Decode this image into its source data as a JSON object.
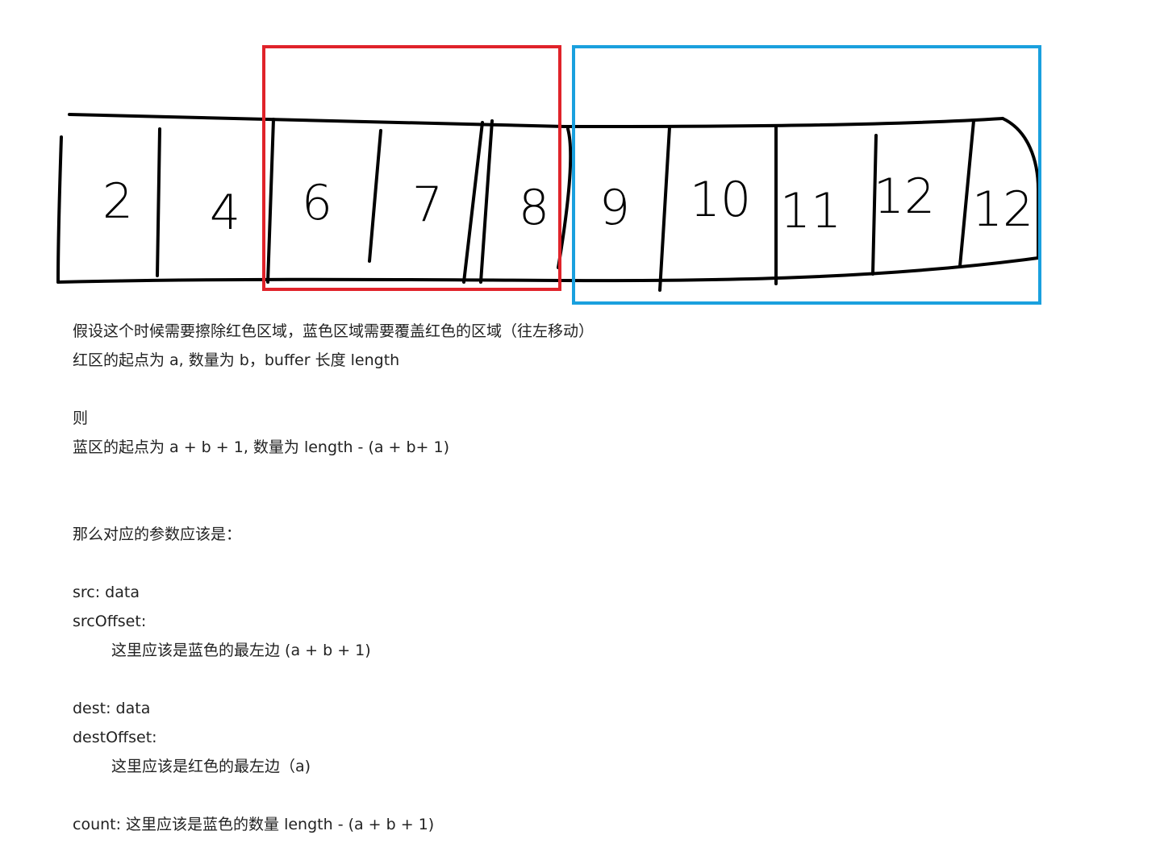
{
  "diagram": {
    "cells": [
      "2",
      "4",
      "6",
      "7",
      "8",
      "9",
      "10",
      "11",
      "12",
      "12"
    ],
    "highlight_colors": {
      "red_region": "#e0232a",
      "blue_region": "#1aa0de"
    }
  },
  "notes": {
    "line1": "假设这个时候需要擦除红色区域，蓝色区域需要覆盖红色的区域（往左移动）",
    "line2": "红区的起点为 a, 数量为 b，buffer 长度 length",
    "line3": "则",
    "line4": "蓝区的起点为 a + b + 1, 数量为 length - (a + b+ 1)",
    "line5": "那么对应的参数应该是：",
    "line6": "src: data",
    "line7": "srcOffset:",
    "line8": "这里应该是蓝色的最左边 (a + b + 1)",
    "line9": "dest: data",
    "line10": "destOffset:",
    "line11": "这里应该是红色的最左边（a)",
    "line12": "count: 这里应该是蓝色的数量 length - (a + b + 1)"
  }
}
